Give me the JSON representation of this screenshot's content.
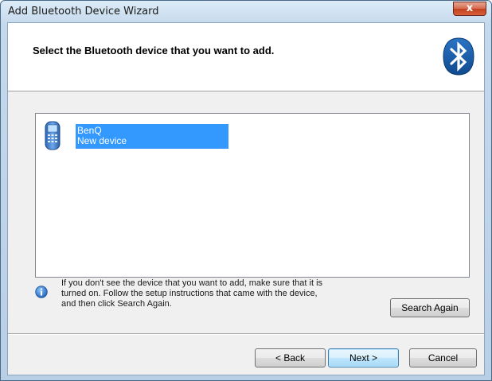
{
  "window": {
    "title": "Add Bluetooth Device Wizard",
    "close_label": "x"
  },
  "header": {
    "title": "Select the Bluetooth device that you want to add."
  },
  "devices": [
    {
      "name": "BenQ",
      "status": "New device",
      "selected": true,
      "icon": "phone-icon"
    }
  ],
  "info": {
    "lines": [
      "If you don't see the device that you want to add, make sure that it is",
      "turned on. Follow the setup instructions that came with the device,",
      "and then click Search Again."
    ]
  },
  "buttons": {
    "search_again": "Search Again",
    "back": "< Back",
    "next": "Next >",
    "cancel": "Cancel"
  },
  "colors": {
    "selection": "#3399ff",
    "bluetooth": "#1b5fa8"
  }
}
